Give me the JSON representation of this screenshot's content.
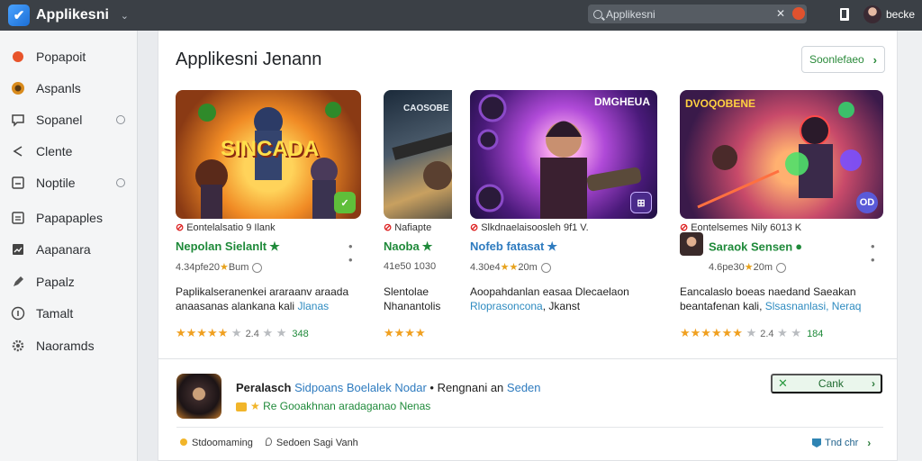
{
  "app": {
    "title": "Applikesni"
  },
  "search": {
    "placeholder": "Applikesni"
  },
  "user": {
    "name": "becke"
  },
  "sidebar": {
    "items": [
      {
        "label": "Popapoit",
        "icon": "orange-circle-icon"
      },
      {
        "label": "Aspanls",
        "icon": "coin-icon"
      },
      {
        "label": "Sopanel",
        "icon": "chat-icon"
      },
      {
        "label": "Clente",
        "icon": "share-icon"
      },
      {
        "label": "Noptile",
        "icon": "tablet-icon"
      },
      {
        "label": "Papapaples",
        "icon": "list-icon"
      },
      {
        "label": "Aapanara",
        "icon": "chart-icon"
      },
      {
        "label": "Papalz",
        "icon": "pen-icon"
      },
      {
        "label": "Tamalt",
        "icon": "info-icon"
      },
      {
        "label": "Naoramds",
        "icon": "gear-icon"
      }
    ]
  },
  "main": {
    "section_title": "Applikesni Jenann",
    "see_more_label": "Soonlefaeo",
    "cards": [
      {
        "art_text": "SINCADA",
        "dev": "Eontelalsatio 9 Ilank",
        "name": "Nepolan Sielanlt",
        "stats": "4.34pfe20",
        "stats_tail": "Bum",
        "desc1": "Paplikalseranenkei araraanv araada",
        "desc2_a": "anaasanas alankana kali",
        "desc2_b": "Jlanas",
        "rating_val": "2.4",
        "rating_cnt": "348"
      },
      {
        "art_text": "CAOSOBE",
        "dev": "Nafiapte",
        "name": "Naoba",
        "stats": "41e50",
        "stats_tail": "1030",
        "desc1": "Slentolae",
        "desc2_a": "Nhanantolis",
        "desc2_b": "",
        "rating_val": "",
        "rating_cnt": ""
      },
      {
        "art_text": "DMGHEUA",
        "dev": "Slkdnaelaisoosleh 9f1 V.",
        "name": "Nofeb fatasat",
        "stats": "4.30e4",
        "stats_tail": "20m",
        "desc1": "Aoopahdanlan easaa Dlecaelaon",
        "desc2_a": "Rloprasoncona",
        "desc2_b": "Jkanst",
        "rating_val": "",
        "rating_cnt": ""
      },
      {
        "art_text": "DVOQOBENE",
        "dev": "Eontelsemes Nily 6013 K",
        "name": "Saraok Sensen",
        "stats": "4.6pe30",
        "stats_tail": "20m",
        "desc1": "Eancalaslo boeas naedand Saeakan",
        "desc2_a": "beantafenan kali",
        "desc2_b": "Slsasnanlasi, Neraq",
        "rating_val": "2.4",
        "rating_cnt": "184"
      }
    ]
  },
  "bottom": {
    "title_bold": "Peralasch",
    "title_accent": "Sidpoans Boelalek Nodar",
    "title_rest": "Rengnani an",
    "title_end": "Seden",
    "subtitle": "Re Gooakhnan aradaganao Nenas",
    "action_label": "Cank",
    "footer_left_a": "Stdoomaming",
    "footer_left_b": "Sedoen Sagi Vanh",
    "footer_right": "Tnd chr"
  },
  "colors": {
    "topbar": "#3b4046",
    "accent_green": "#1f8a3a",
    "accent_blue": "#2e7bbf"
  }
}
